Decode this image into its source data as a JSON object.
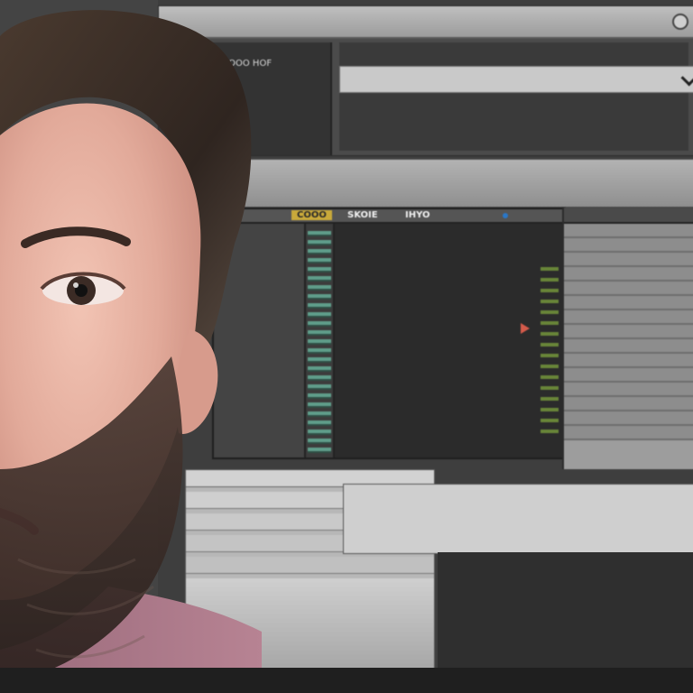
{
  "colors": {
    "window_dark": "#4a4a4a",
    "panel_gray": "#a6a6a6",
    "accent_yellow": "#c9a93a",
    "accent_teal": "#5f9d8a",
    "lower_dark": "#2f2f2f"
  },
  "icons": [
    "checkmark-icon",
    "settings-icon",
    "play-icon",
    "info-icon"
  ],
  "top_window": {
    "title": "",
    "left_lines": [
      "CC OOO HOF",
      "",
      "",
      "",
      ""
    ],
    "right_lines": [
      "",
      "",
      "",
      "",
      ""
    ],
    "header_note": ""
  },
  "middle_strip": {
    "lines": [
      "",
      "",
      ""
    ]
  },
  "editor": {
    "tabs": [
      "COOO",
      "SKOIE",
      "IHYO"
    ],
    "left_list": [
      "",
      "",
      "",
      "",
      "",
      "",
      "",
      "",
      "",
      "",
      "",
      ""
    ],
    "right_panel_title": "",
    "right_panel_rows": [
      "",
      "",
      "",
      "",
      "",
      "",
      "",
      "",
      "",
      "",
      "",
      "",
      "",
      "",
      ""
    ]
  },
  "lower": {
    "lines": [
      "",
      "",
      ""
    ]
  }
}
